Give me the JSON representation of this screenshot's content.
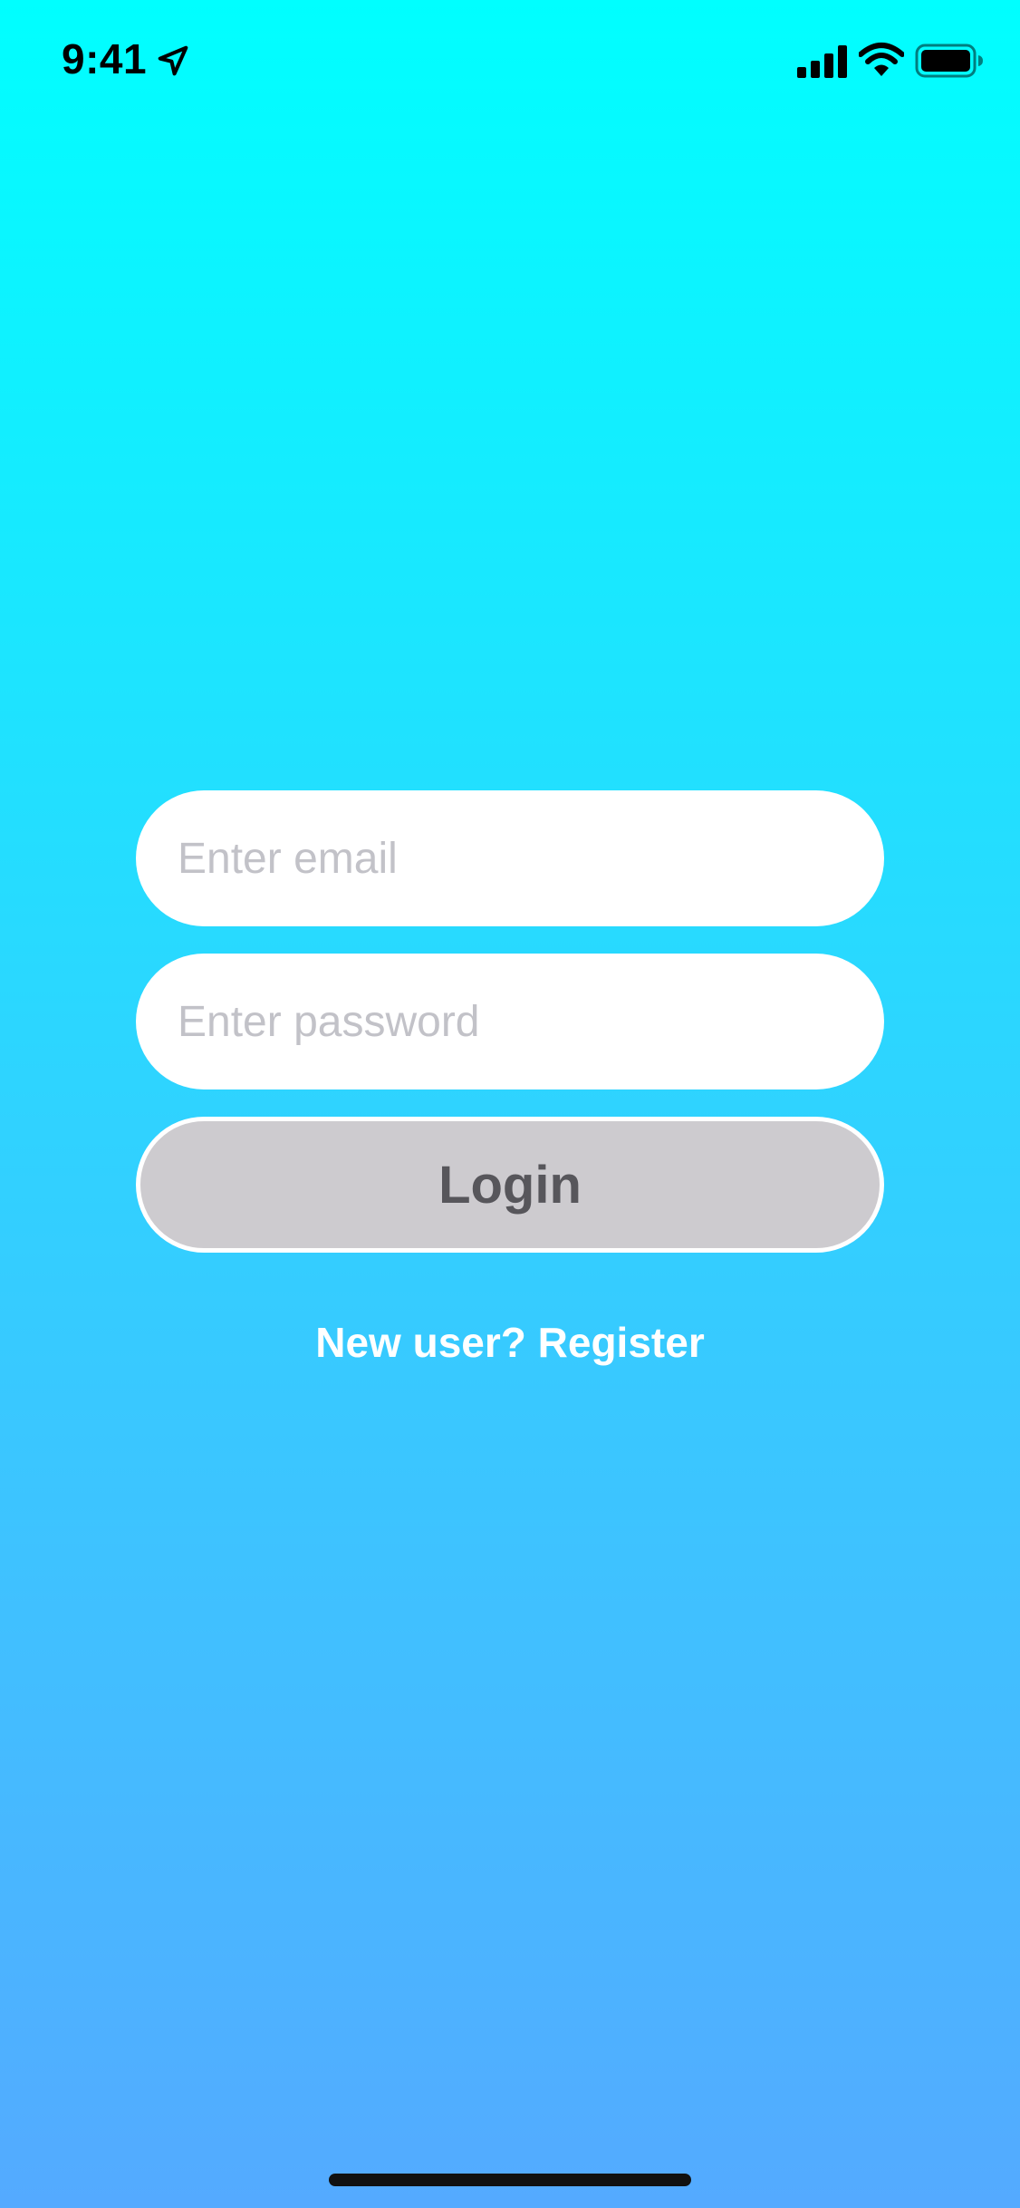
{
  "status_bar": {
    "time": "9:41",
    "icons": [
      "location-arrow-icon",
      "cellular-signal-icon",
      "wifi-icon",
      "battery-icon"
    ]
  },
  "login": {
    "email_placeholder": "Enter email",
    "email_value": "",
    "password_placeholder": "Enter password",
    "password_value": "",
    "login_label": "Login",
    "register_label": "New user? Register"
  },
  "colors": {
    "gradient_top": "#00ffff",
    "gradient_bottom": "#54aaff",
    "button_bg": "#cdcbcf",
    "button_text": "#57565b",
    "placeholder": "#c2c2c8"
  }
}
